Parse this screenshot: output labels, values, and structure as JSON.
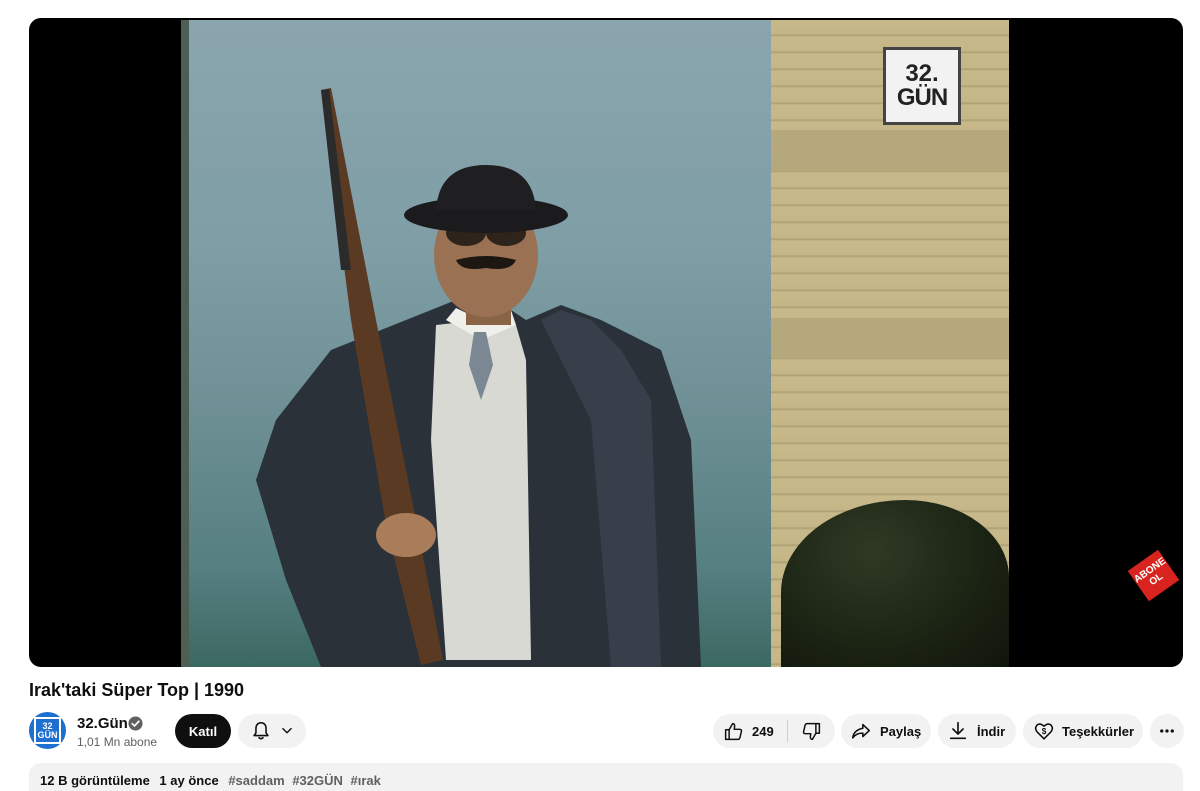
{
  "video": {
    "channel_logo": {
      "line1": "32.",
      "line2": "GÜN"
    },
    "subscribe_badge": {
      "line1": "ABONE",
      "line2": "OL"
    }
  },
  "title": "Irak'taki Süper Top | 1990",
  "channel": {
    "avatar": {
      "line1": "32",
      "line2": "GÜN"
    },
    "name": "32.Gün",
    "verified_icon": "verified-check-icon",
    "subscribers": "1,01 Mn abone",
    "join_label": "Katıl",
    "bell_icon": "bell-icon"
  },
  "actions": {
    "like_count": "249",
    "share_label": "Paylaş",
    "download_label": "İndir",
    "thanks_label": "Teşekkürler"
  },
  "description": {
    "views": "12 B görüntüleme",
    "ago": "1 ay önce",
    "tags": [
      "#saddam",
      "#32GÜN",
      "#ırak"
    ]
  },
  "colors": {
    "accent": "#0f0f0f",
    "pill_bg": "#f2f2f2",
    "avatar_blue": "#1f6fd1",
    "abone_red": "#d8231e"
  }
}
